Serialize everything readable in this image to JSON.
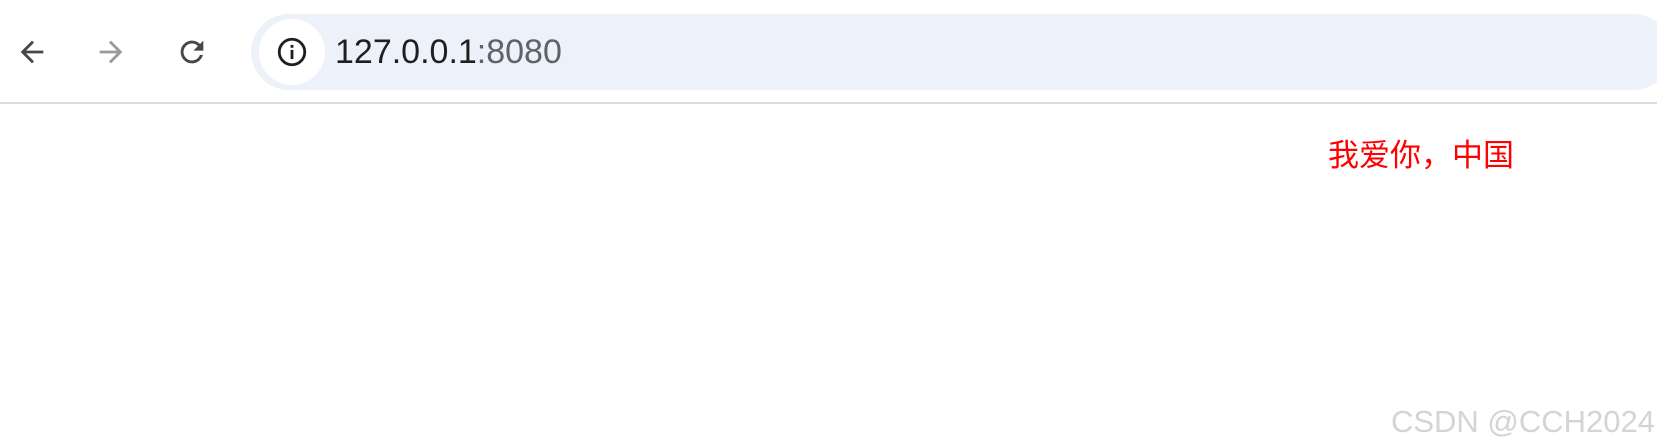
{
  "browser": {
    "address_bar": {
      "host": "127.0.0.1",
      "port": ":8080"
    },
    "icons": {
      "back": "arrow-left-icon",
      "forward": "arrow-right-icon",
      "reload": "reload-icon",
      "site_info": "info-icon"
    },
    "colors": {
      "omnibox_bg": "#edf1f9",
      "icon_active": "#474747",
      "icon_disabled": "#9a9a9a"
    }
  },
  "page": {
    "main_text": "我爱你，中国",
    "main_text_color": "#ff0000",
    "watermark": "CSDN @CCH2024"
  }
}
